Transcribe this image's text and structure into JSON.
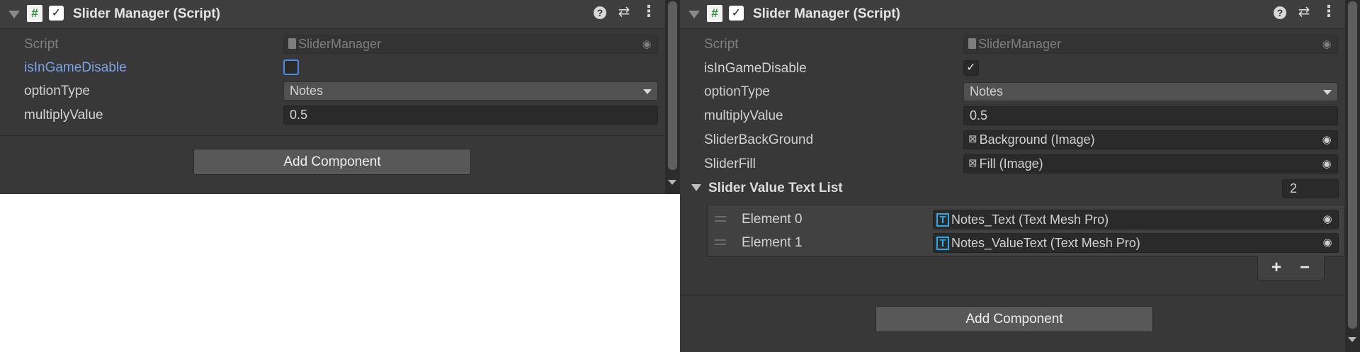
{
  "left": {
    "header": {
      "enabled_check": "✓",
      "title": "Slider Manager (Script)",
      "help_glyph": "?",
      "settings_glyph": "⇄",
      "menu_glyph": "⋮"
    },
    "rows": {
      "script": {
        "label": "Script",
        "value": "SliderManager"
      },
      "is_in_game_disable": {
        "label": "isInGameDisable",
        "checked": false,
        "check_glyph": ""
      },
      "option_type": {
        "label": "optionType",
        "value": "Notes"
      },
      "multiply_value": {
        "label": "multiplyValue",
        "value": "0.5"
      }
    },
    "add_component_label": "Add Component"
  },
  "right": {
    "header": {
      "enabled_check": "✓",
      "title": "Slider Manager (Script)",
      "help_glyph": "?",
      "settings_glyph": "⇄",
      "menu_glyph": "⋮"
    },
    "rows": {
      "script": {
        "label": "Script",
        "value": "SliderManager"
      },
      "is_in_game_disable": {
        "label": "isInGameDisable",
        "checked": true,
        "check_glyph": "✓"
      },
      "option_type": {
        "label": "optionType",
        "value": "Notes"
      },
      "multiply_value": {
        "label": "multiplyValue",
        "value": "0.5"
      },
      "slider_background": {
        "label": "SliderBackGround",
        "value": "Background (Image)"
      },
      "slider_fill": {
        "label": "SliderFill",
        "value": "Fill (Image)"
      }
    },
    "list": {
      "title": "Slider Value Text List",
      "size": "2",
      "elements": [
        {
          "label": "Element 0",
          "value": "Notes_Text (Text Mesh Pro)"
        },
        {
          "label": "Element 1",
          "value": "Notes_ValueText (Text Mesh Pro)"
        }
      ],
      "add_glyph": "+",
      "remove_glyph": "−"
    },
    "add_component_label": "Add Component"
  },
  "icons": {
    "script": "csharp-script-icon",
    "object_picker": "circle-target-icon",
    "image_object": "image-component-icon",
    "text_mesh_pro": "tmp-text-icon"
  },
  "colors": {
    "panel_bg": "#383838",
    "focused_label": "#7ba4e8",
    "tmp_icon": "#2fa8e8"
  }
}
